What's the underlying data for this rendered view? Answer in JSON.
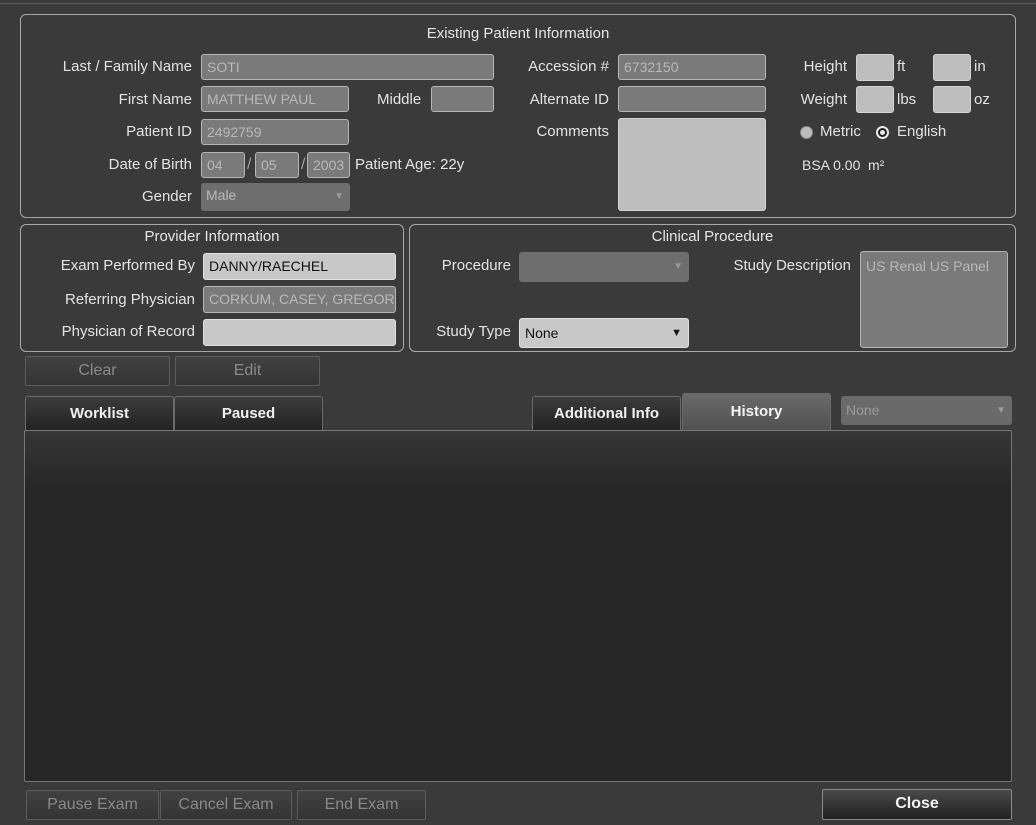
{
  "patient": {
    "title": "Existing Patient Information",
    "last_name_label": "Last / Family Name",
    "last_name_value": "SOTI",
    "first_name_label": "First Name",
    "first_name_value": "MATTHEW PAUL",
    "middle_label": "Middle",
    "middle_value": "",
    "patient_id_label": "Patient ID",
    "patient_id_value": "2492759",
    "dob_label": "Date of Birth",
    "dob_month": "04",
    "dob_day": "05",
    "dob_year": "2003",
    "dob_sep": "/",
    "age_text": "Patient Age: 22y",
    "gender_label": "Gender",
    "gender_value": "Male",
    "accession_label": "Accession #",
    "accession_value": "6732150",
    "alternate_id_label": "Alternate ID",
    "alternate_id_value": "",
    "comments_label": "Comments",
    "comments_value": "",
    "height_label": "Height",
    "height_ft_unit": "ft",
    "height_in_unit": "in",
    "weight_label": "Weight",
    "weight_lbs_unit": "lbs",
    "weight_oz_unit": "oz",
    "metric_label": "Metric",
    "english_label": "English",
    "unit_system_selected": "English",
    "bsa_text": "BSA 0.00",
    "bsa_unit": "m²"
  },
  "provider": {
    "title": "Provider Information",
    "exam_by_label": "Exam Performed By",
    "exam_by_value": "DANNY/RAECHEL",
    "referring_label": "Referring Physician",
    "referring_value": "CORKUM, CASEY, GREGOR",
    "record_label": "Physician of Record",
    "record_value": ""
  },
  "clinical": {
    "title": "Clinical Procedure",
    "procedure_label": "Procedure",
    "procedure_value": "",
    "study_type_label": "Study Type",
    "study_type_value": "None",
    "study_desc_label": "Study Description",
    "study_desc_value": "US Renal US Panel"
  },
  "actions": {
    "clear": "Clear",
    "edit": "Edit"
  },
  "tabs": {
    "worklist": "Worklist",
    "paused": "Paused",
    "additional_info": "Additional Info",
    "history": "History",
    "filter_value": "None"
  },
  "footer": {
    "pause_exam": "Pause Exam",
    "cancel_exam": "Cancel Exam",
    "end_exam": "End Exam",
    "close": "Close"
  },
  "icons": {
    "dropdown": "chevron-down-icon"
  },
  "colors": {
    "background": "#3a3a3a",
    "panel_border": "#a8a8a8",
    "readonly_field": "#7a7a7a",
    "editable_field": "#bdbdbd"
  }
}
